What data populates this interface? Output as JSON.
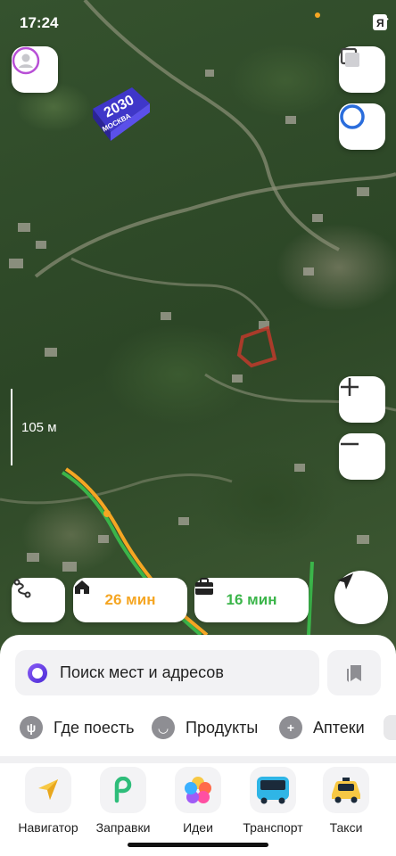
{
  "status_bar": {
    "time": "17:24"
  },
  "map": {
    "scale_label": "105 м",
    "badge_year": "2030",
    "badge_city": "МОСКВА"
  },
  "route_bar": {
    "home_time": "26 мин",
    "work_time": "16 мин",
    "home_color": "#f5a623",
    "work_color": "#3bb54a"
  },
  "search": {
    "placeholder": "Поиск мест и адресов"
  },
  "categories": [
    {
      "label": "Где поесть",
      "icon": "fork-knife-icon"
    },
    {
      "label": "Продукты",
      "icon": "basket-icon"
    },
    {
      "label": "Аптеки",
      "icon": "plus-icon"
    }
  ],
  "apps": [
    {
      "label": "Навигатор",
      "icon": "navigator-icon"
    },
    {
      "label": "Заправки",
      "icon": "fuel-icon"
    },
    {
      "label": "Идеи",
      "icon": "ideas-icon"
    },
    {
      "label": "Транспорт",
      "icon": "bus-icon"
    },
    {
      "label": "Такси",
      "icon": "taxi-icon"
    }
  ],
  "colors": {
    "accent": "#4b2bd6",
    "sheet_bg": "#ffffff"
  }
}
